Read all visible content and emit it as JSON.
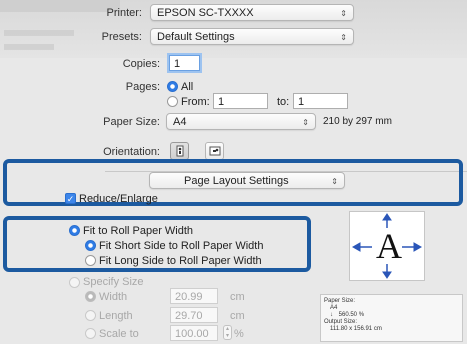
{
  "printer": {
    "label": "Printer:",
    "value": "EPSON SC-TXXXX"
  },
  "presets": {
    "label": "Presets:",
    "value": "Default Settings"
  },
  "copies": {
    "label": "Copies:",
    "value": "1"
  },
  "pages": {
    "label": "Pages:",
    "all": "All",
    "from_label": "From:",
    "from_value": "1",
    "to_label": "to:",
    "to_value": "1"
  },
  "paper_size": {
    "label": "Paper Size:",
    "value": "A4",
    "dimensions": "210 by 297 mm"
  },
  "orientation": {
    "label": "Orientation:"
  },
  "panel_popup": {
    "value": "Page Layout Settings"
  },
  "reduce_enlarge": {
    "label": "Reduce/Enlarge"
  },
  "fit_roll": {
    "main": "Fit to Roll Paper Width",
    "short": "Fit Short Side to Roll Paper Width",
    "long": "Fit Long Side to Roll Paper Width"
  },
  "specify_size": {
    "label": "Specify Size",
    "width_label": "Width",
    "width_value": "20.99",
    "width_unit": "cm",
    "length_label": "Length",
    "length_value": "29.70",
    "length_unit": "cm",
    "scale_label": "Scale to",
    "scale_value": "100.00",
    "scale_unit": "%"
  },
  "preview": {
    "letter": "A"
  },
  "info": {
    "paper_size_label": "Paper Size:",
    "paper_size_value": "A4",
    "scale_value": "560.50  %",
    "output_size_label": "Output Size:",
    "output_size_value": "111.80 x 156.91 cm"
  },
  "colors": {
    "highlight": "#1c5aa0",
    "accent": "#2f7ce6"
  }
}
